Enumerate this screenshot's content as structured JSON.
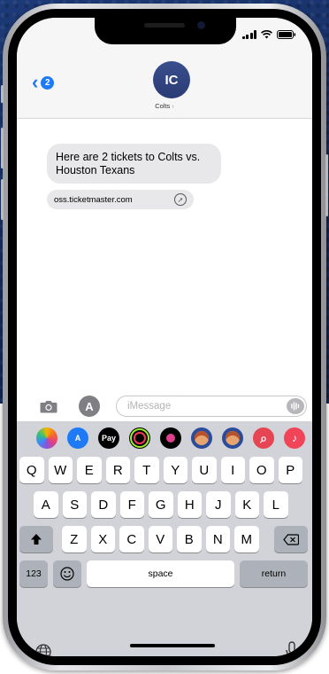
{
  "status": {
    "time": ""
  },
  "conversation": {
    "back_badge": "2",
    "avatar_initials": "IC",
    "contact_name": "Colts",
    "message_text": "Here are 2 tickets to Colts vs. Houston Texans",
    "link_domain": "oss.ticketmaster.com"
  },
  "composer": {
    "placeholder": "iMessage"
  },
  "app_strip": [
    {
      "name": "photos-app",
      "color": "#ffffff"
    },
    {
      "name": "app-store",
      "color": "#1f7af6"
    },
    {
      "name": "apple-pay",
      "color": "#000000",
      "label": "Pay"
    },
    {
      "name": "activity",
      "color": "#000000"
    },
    {
      "name": "digital-touch",
      "color": "#000000"
    },
    {
      "name": "memoji-1",
      "color": "#2a4c9a"
    },
    {
      "name": "memoji-2",
      "color": "#2a4c9a"
    },
    {
      "name": "images-search",
      "color": "#e64553"
    },
    {
      "name": "music",
      "color": "#f24458"
    }
  ],
  "keyboard": {
    "row1": [
      "Q",
      "W",
      "E",
      "R",
      "T",
      "Y",
      "U",
      "I",
      "O",
      "P"
    ],
    "row2": [
      "A",
      "S",
      "D",
      "F",
      "G",
      "H",
      "J",
      "K",
      "L"
    ],
    "row3": [
      "Z",
      "X",
      "C",
      "V",
      "B",
      "N",
      "M"
    ],
    "numbers_key": "123",
    "space_key": "space",
    "return_key": "return"
  }
}
